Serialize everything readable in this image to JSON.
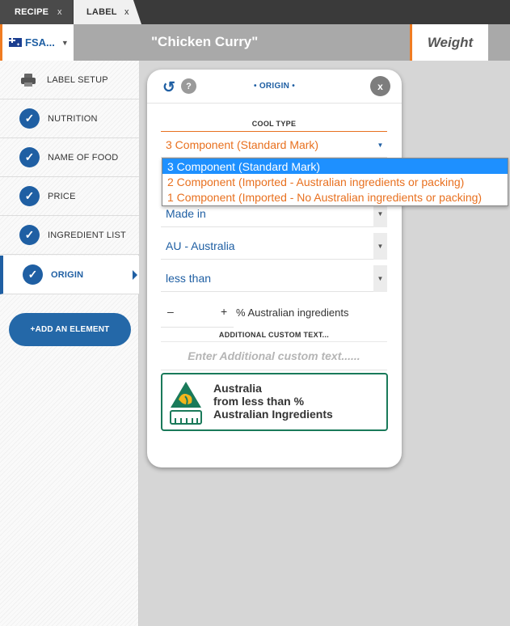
{
  "tabs": [
    {
      "label": "RECIPE",
      "close": "x"
    },
    {
      "label": "LABEL",
      "close": "x"
    }
  ],
  "header": {
    "region": "FSA...",
    "region_caret": "▼",
    "recipe_title": "\"Chicken Curry\"",
    "weight_label": "Weight"
  },
  "sidebar": {
    "items": [
      {
        "label": "LABEL SETUP"
      },
      {
        "label": "NUTRITION"
      },
      {
        "label": "NAME OF FOOD"
      },
      {
        "label": "PRICE"
      },
      {
        "label": "INGREDIENT LIST"
      },
      {
        "label": "ORIGIN"
      }
    ],
    "check_glyph": "✓",
    "add_element": "+ADD AN ELEMENT"
  },
  "panel": {
    "undo_glyph": "↺",
    "help_glyph": "?",
    "title": "• ORIGIN •",
    "close_glyph": "x",
    "cool_type_label": "COOL TYPE",
    "cool_type_value": "3 Component (Standard Mark)",
    "caret_glyph": "▼",
    "made_value": "Made in",
    "country_value": "AU - Australia",
    "comparison_value": "less than",
    "stepper_minus": "–",
    "stepper_plus": "+",
    "pct_label": "% Australian ingredients",
    "custom_text_label": "ADDITIONAL CUSTOM TEXT...",
    "custom_text_placeholder": "Enter Additional custom text......",
    "preview_lines": [
      "Australia",
      "from less than %",
      "Australian Ingredients"
    ]
  },
  "dropdown": {
    "options": [
      "3 Component (Standard Mark)",
      "2 Component (Imported - Australian ingredients or packing)",
      "1 Component (Imported - No Australian ingredients or packing)"
    ],
    "selected_index": 0
  },
  "colors": {
    "accent_blue": "#1f5fa3",
    "accent_orange": "#e8701f",
    "logo_green": "#1a7a5a",
    "logo_gold": "#f2b51c"
  }
}
